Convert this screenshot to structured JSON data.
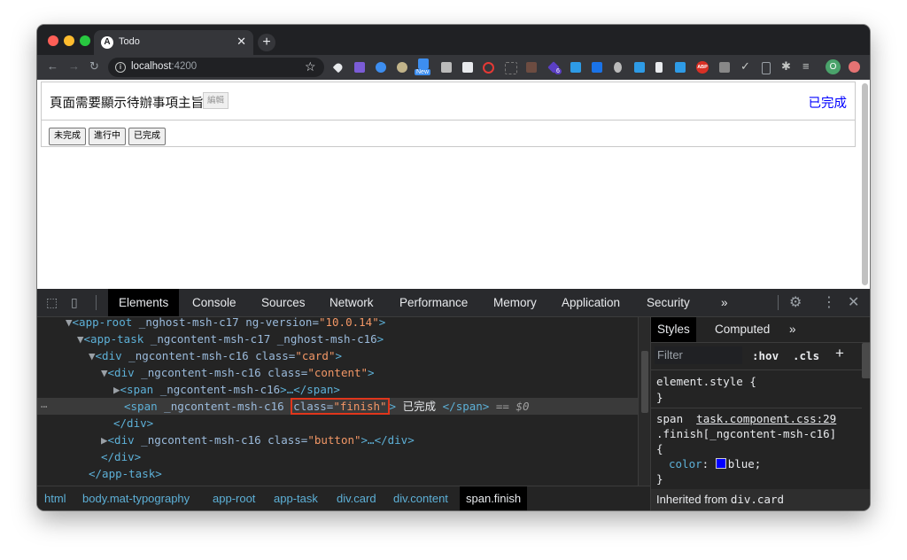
{
  "browser": {
    "tab_title": "Todo",
    "tab_favicon": "A",
    "url_host": "localhost",
    "url_port": ":4200",
    "new_tab": "+",
    "extension_badges": {
      "new": "New",
      "count": "6",
      "abp": "ABP",
      "profile": "O"
    }
  },
  "app": {
    "task_title": "頁面需要顯示待辦事項主旨",
    "edit_label": "編輯",
    "status_text": "已完成",
    "status_color": "#0000ff",
    "buttons": [
      "未完成",
      "進行中",
      "已完成"
    ]
  },
  "devtools": {
    "tabs": [
      "Elements",
      "Console",
      "Sources",
      "Network",
      "Performance",
      "Memory",
      "Application",
      "Security",
      "»"
    ],
    "active_tab": "Elements",
    "dom": {
      "l1_tag": "<app-root",
      "l1_attrs": " _nghost-msh-c17 ng-version=",
      "l1_val": "\"10.0.14\"",
      "l1_end": ">",
      "l2_tag": "<app-task",
      "l2_attrs": " _ngcontent-msh-c17 _nghost-msh-c16",
      "l2_end": ">",
      "l3_tag": "<div",
      "l3_attrs": " _ngcontent-msh-c16 class=",
      "l3_val": "\"card\"",
      "l3_end": ">",
      "l4_tag": "<div",
      "l4_attrs": " _ngcontent-msh-c16 class=",
      "l4_val": "\"content\"",
      "l4_end": ">",
      "l5_tag": "<span",
      "l5_attrs": " _ngcontent-msh-c16",
      "l5_end": ">…</span>",
      "l6_tag": "<span",
      "l6_attrs": " _ngcontent-msh-c16",
      "l6_hl_attr": "class=",
      "l6_hl_val": "\"finish\"",
      "l6_end": ">",
      "l6_text": " 已完成 ",
      "l6_close": "</span>",
      "l6_eq": " == ",
      "l6_dollar": "$0",
      "l7": "</div>",
      "l8_tag": "<div",
      "l8_attrs": " _ngcontent-msh-c16 class=",
      "l8_val": "\"button\"",
      "l8_end": ">…</div>",
      "l9": "</div>",
      "l10": "</app-task>",
      "dots": "⋯"
    },
    "breadcrumbs": [
      "html",
      "body.mat-typography",
      "app-root",
      "app-task",
      "div.card",
      "div.content",
      "span.finish"
    ],
    "styles_tabs": [
      "Styles",
      "Computed",
      "»"
    ],
    "filter_placeholder": "Filter",
    "hov": ":hov",
    "cls": ".cls",
    "add": "+",
    "element_style": "element.style {",
    "brace_close": "}",
    "rule_selector_el": "span",
    "rule_source": "task.component.css:29",
    "rule_selector": ".finish[_ngcontent-msh-c16]",
    "brace_open": "{",
    "prop_name": "color",
    "prop_value": "blue;",
    "inherited_label": "Inherited from ",
    "inherited_el": "div.card"
  }
}
